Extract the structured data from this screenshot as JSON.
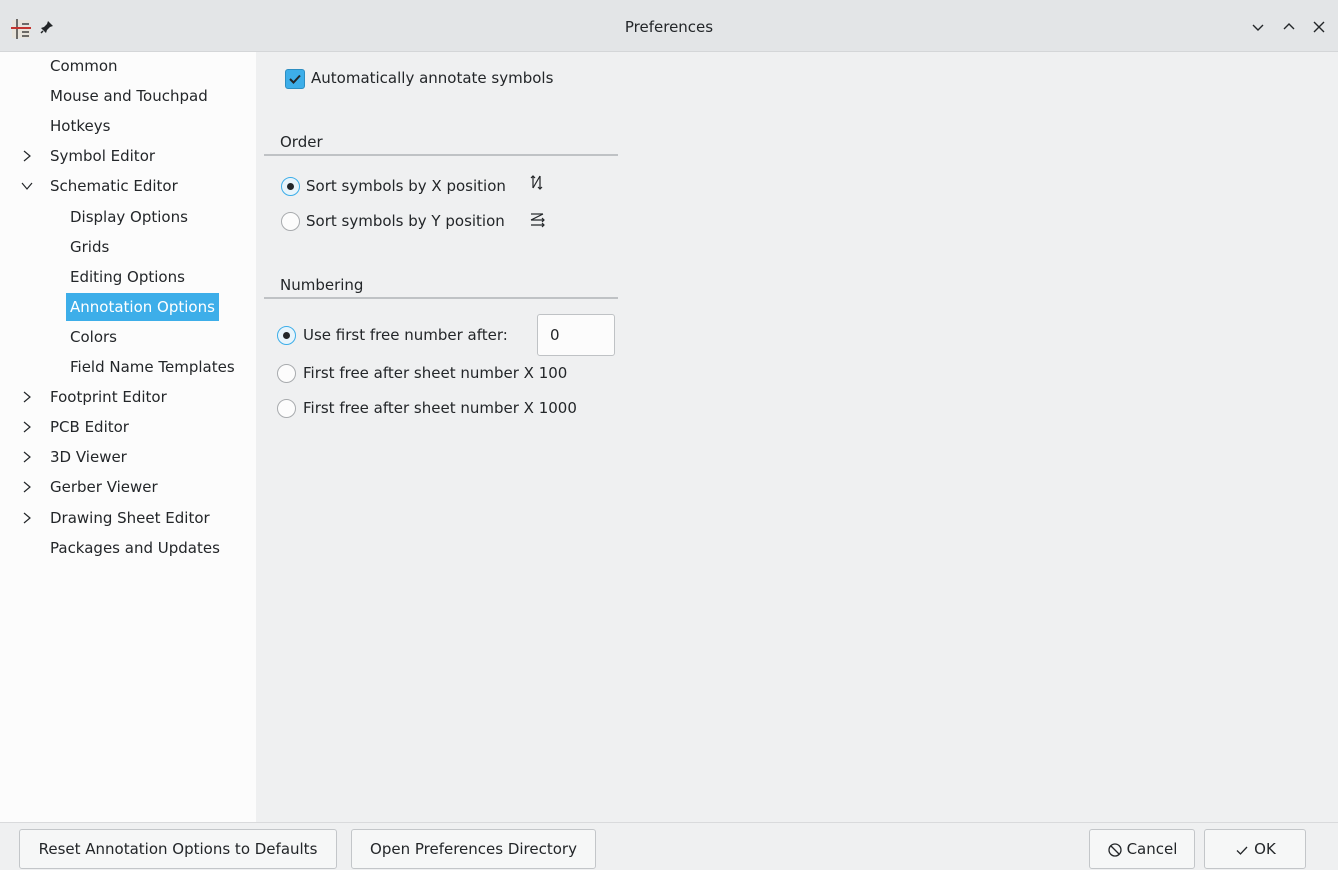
{
  "window": {
    "title": "Preferences"
  },
  "sidebar": {
    "items": [
      {
        "label": "Common",
        "level": 0,
        "expander": "none"
      },
      {
        "label": "Mouse and Touchpad",
        "level": 0,
        "expander": "none"
      },
      {
        "label": "Hotkeys",
        "level": 0,
        "expander": "none"
      },
      {
        "label": "Symbol Editor",
        "level": 0,
        "expander": "collapsed"
      },
      {
        "label": "Schematic Editor",
        "level": 0,
        "expander": "expanded"
      },
      {
        "label": "Display Options",
        "level": 1,
        "expander": "none"
      },
      {
        "label": "Grids",
        "level": 1,
        "expander": "none"
      },
      {
        "label": "Editing Options",
        "level": 1,
        "expander": "none"
      },
      {
        "label": "Annotation Options",
        "level": 1,
        "expander": "none",
        "selected": true
      },
      {
        "label": "Colors",
        "level": 1,
        "expander": "none"
      },
      {
        "label": "Field Name Templates",
        "level": 1,
        "expander": "none"
      },
      {
        "label": "Footprint Editor",
        "level": 0,
        "expander": "collapsed"
      },
      {
        "label": "PCB Editor",
        "level": 0,
        "expander": "collapsed"
      },
      {
        "label": "3D Viewer",
        "level": 0,
        "expander": "collapsed"
      },
      {
        "label": "Gerber Viewer",
        "level": 0,
        "expander": "collapsed"
      },
      {
        "label": "Drawing Sheet Editor",
        "level": 0,
        "expander": "collapsed"
      },
      {
        "label": "Packages and Updates",
        "level": 0,
        "expander": "none"
      }
    ]
  },
  "annotation": {
    "auto_annotate_label": "Automatically annotate symbols",
    "auto_annotate_checked": true,
    "order_title": "Order",
    "sort_x_label": "Sort symbols by X position",
    "sort_x_checked": true,
    "sort_y_label": "Sort symbols by Y position",
    "sort_y_checked": false,
    "numbering_title": "Numbering",
    "first_free_label": "Use first free number after:",
    "first_free_checked": true,
    "first_free_value": "0",
    "sheet_x100_label": "First free after sheet number X 100",
    "sheet_x100_checked": false,
    "sheet_x1000_label": "First free after sheet number X 1000",
    "sheet_x1000_checked": false
  },
  "buttons": {
    "reset_label": "Reset Annotation Options to Defaults",
    "open_dir_label": "Open Preferences Directory",
    "cancel_label": "Cancel",
    "ok_label": "OK"
  },
  "colors": {
    "accent": "#3daee9",
    "sidebar_bg": "#fcfcfc",
    "window_bg": "#eff0f1"
  },
  "icons": {
    "app": "kicad-eeschema-icon",
    "pin": "pin-icon",
    "minimize": "chevron-down-icon",
    "maximize": "chevron-up-icon",
    "close": "close-icon",
    "cancel": "cancel-icon",
    "ok": "check-icon"
  }
}
